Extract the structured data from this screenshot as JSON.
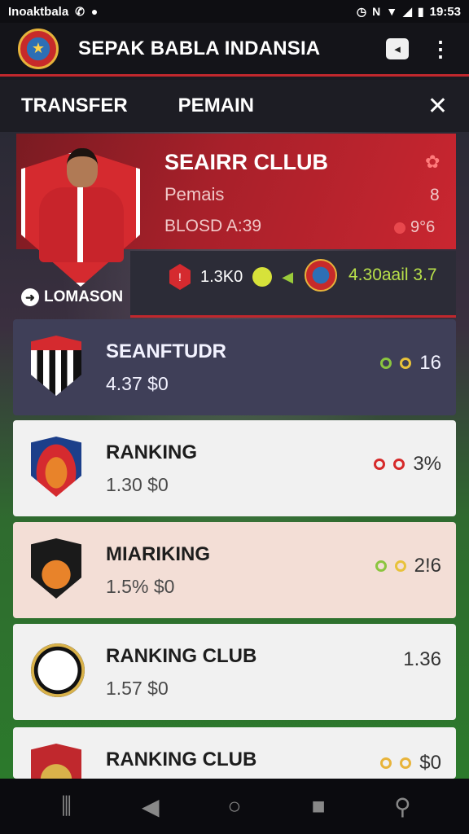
{
  "status_bar": {
    "left_text": "Inoaktbala",
    "time": "19:53",
    "icons": [
      "whatsapp-icon",
      "notification-icon",
      "alarm-icon",
      "nfc-icon",
      "wifi-icon",
      "signal-icon",
      "battery-icon"
    ]
  },
  "app_bar": {
    "title": "SEPAK BABLA INDANSIA",
    "logo_icon": "club-crest-icon",
    "actions": [
      "screen-share-icon",
      "more-vert-icon"
    ]
  },
  "tabs": [
    {
      "label": "TRANSFER"
    },
    {
      "label": "PEMAIN"
    }
  ],
  "close_icon": "close-icon",
  "featured": {
    "title": "SEAIRR CLLUB",
    "subtitle": "Pemais",
    "meta": "BLOSD A:39",
    "top_right_value": "8",
    "right_value": "9°6",
    "location_label": "LOMASON",
    "stat_left": "1.3K0",
    "stat_right": "4.30aail 3.7",
    "colors": {
      "accent": "#c0282d",
      "ball": "#d7e23a",
      "stat": "#b8e04a"
    }
  },
  "rankings": [
    {
      "name": "SEANFTUDR",
      "price": "4.37 $0",
      "right_value": "16",
      "dot_colors": [
        "#8bc53f",
        "#e8c23a"
      ],
      "style": "dark",
      "crest_icon": "striped-shield-icon"
    },
    {
      "name": "RANKING",
      "price": "1.30 $0",
      "right_value": "3%",
      "dot_colors": [
        "#d62a2a",
        "#d62a2a"
      ],
      "style": "light",
      "crest_icon": "flame-shield-icon"
    },
    {
      "name": "MIARIKING",
      "price": "1.5% $0",
      "right_value": "2!6",
      "dot_colors": [
        "#8bc53f",
        "#e8c23a"
      ],
      "style": "pink",
      "crest_icon": "tiger-shield-icon"
    },
    {
      "name": "RANKING CLUB",
      "price": "1.57 $0",
      "right_value": "1.36",
      "dot_colors": [],
      "style": "light",
      "crest_icon": "panther-circle-icon"
    },
    {
      "name": "RANKING CLUB",
      "price": "",
      "right_value": "$0",
      "dot_colors": [
        "#e8b43a",
        "#e8b43a"
      ],
      "style": "light",
      "crest_icon": "red-shield-icon"
    }
  ],
  "nav_bar": {
    "items": [
      "recents-icon",
      "back-icon",
      "home-icon",
      "overview-icon",
      "search-icon"
    ]
  }
}
